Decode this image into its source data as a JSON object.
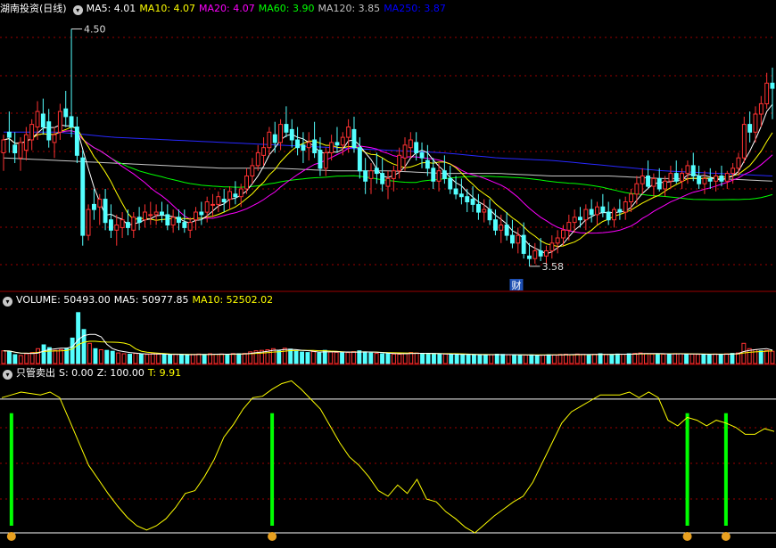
{
  "price_panel": {
    "title": "湖南投资(日线)",
    "ma": [
      {
        "label": "MA5: 4.01",
        "color": "#ffffff"
      },
      {
        "label": "MA10: 4.07",
        "color": "#ffff00"
      },
      {
        "label": "MA20: 4.07",
        "color": "#ff00ff"
      },
      {
        "label": "MA60: 3.90",
        "color": "#00ff00"
      },
      {
        "label": "MA120: 3.85",
        "color": "#c0c0c0"
      },
      {
        "label": "MA250: 3.87",
        "color": "#0000ff"
      }
    ],
    "high_label": "4.50",
    "low_label": "3.58",
    "event_badge": "财"
  },
  "volume_panel": {
    "label": "VOLUME: 50493.00",
    "ma": [
      {
        "label": "MA5: 50977.85",
        "color": "#ffffff"
      },
      {
        "label": "MA10: 52502.02",
        "color": "#ffff00"
      }
    ]
  },
  "indicator_panel": {
    "title": "只管卖出",
    "values": [
      {
        "label": "S: 0.00",
        "color": "#ffffff"
      },
      {
        "label": "Z: 100.00",
        "color": "#ffffff"
      },
      {
        "label": "T: 9.91",
        "color": "#ffff00"
      }
    ]
  },
  "colors": {
    "up": "#ff3232",
    "down": "#54ffff",
    "grid": "#9b0000",
    "signal": "#00ff00",
    "t_line": "#ffff00"
  },
  "chart_data": [
    {
      "type": "candlestick",
      "title": "湖南投资(日线)",
      "ylim": [
        3.5,
        4.55
      ],
      "series_note": "daily OHLC, estimated from the figure",
      "ohlc": [
        [
          4.02,
          4.09,
          3.95,
          4.07
        ],
        [
          4.1,
          4.18,
          4.02,
          4.08
        ],
        [
          4.05,
          4.1,
          3.98,
          4.02
        ],
        [
          4.0,
          4.08,
          3.95,
          4.06
        ],
        [
          4.03,
          4.12,
          3.99,
          4.09
        ],
        [
          4.07,
          4.15,
          4.03,
          4.13
        ],
        [
          4.12,
          4.22,
          4.07,
          4.18
        ],
        [
          4.17,
          4.23,
          4.09,
          4.12
        ],
        [
          4.14,
          4.19,
          4.04,
          4.07
        ],
        [
          4.06,
          4.12,
          4.0,
          4.09
        ],
        [
          4.1,
          4.21,
          4.07,
          4.18
        ],
        [
          4.19,
          4.26,
          4.12,
          4.16
        ],
        [
          4.16,
          4.5,
          4.08,
          4.12
        ],
        [
          4.12,
          4.16,
          3.98,
          4.01
        ],
        [
          4.0,
          4.03,
          3.66,
          3.7
        ],
        [
          3.7,
          3.82,
          3.68,
          3.8
        ],
        [
          3.82,
          3.88,
          3.76,
          3.8
        ],
        [
          3.81,
          3.86,
          3.74,
          3.84
        ],
        [
          3.84,
          3.88,
          3.72,
          3.75
        ],
        [
          3.76,
          3.82,
          3.69,
          3.72
        ],
        [
          3.72,
          3.78,
          3.66,
          3.74
        ],
        [
          3.73,
          3.79,
          3.69,
          3.76
        ],
        [
          3.75,
          3.8,
          3.7,
          3.73
        ],
        [
          3.72,
          3.79,
          3.69,
          3.77
        ],
        [
          3.77,
          3.81,
          3.72,
          3.75
        ],
        [
          3.76,
          3.82,
          3.73,
          3.79
        ],
        [
          3.78,
          3.83,
          3.74,
          3.78
        ],
        [
          3.78,
          3.82,
          3.74,
          3.79
        ],
        [
          3.79,
          3.83,
          3.75,
          3.78
        ],
        [
          3.78,
          3.82,
          3.72,
          3.74
        ],
        [
          3.74,
          3.8,
          3.71,
          3.77
        ],
        [
          3.77,
          3.8,
          3.72,
          3.75
        ],
        [
          3.75,
          3.8,
          3.71,
          3.73
        ],
        [
          3.72,
          3.77,
          3.69,
          3.75
        ],
        [
          3.76,
          3.81,
          3.72,
          3.79
        ],
        [
          3.79,
          3.83,
          3.74,
          3.78
        ],
        [
          3.79,
          3.85,
          3.75,
          3.83
        ],
        [
          3.82,
          3.86,
          3.77,
          3.82
        ],
        [
          3.82,
          3.87,
          3.79,
          3.85
        ],
        [
          3.84,
          3.88,
          3.79,
          3.83
        ],
        [
          3.84,
          3.89,
          3.8,
          3.87
        ],
        [
          3.86,
          3.91,
          3.82,
          3.85
        ],
        [
          3.85,
          3.9,
          3.81,
          3.88
        ],
        [
          3.88,
          3.96,
          3.86,
          3.93
        ],
        [
          3.93,
          4.0,
          3.9,
          3.97
        ],
        [
          3.97,
          4.05,
          3.95,
          4.02
        ],
        [
          4.01,
          4.08,
          3.97,
          4.04
        ],
        [
          4.04,
          4.12,
          4.01,
          4.1
        ],
        [
          4.09,
          4.14,
          4.02,
          4.06
        ],
        [
          4.06,
          4.15,
          4.03,
          4.13
        ],
        [
          4.13,
          4.2,
          4.08,
          4.1
        ],
        [
          4.11,
          4.15,
          4.04,
          4.07
        ],
        [
          4.07,
          4.12,
          4.01,
          4.04
        ],
        [
          4.05,
          4.1,
          3.98,
          4.03
        ],
        [
          4.04,
          4.1,
          3.99,
          4.06
        ],
        [
          4.07,
          4.14,
          4.0,
          4.02
        ],
        [
          4.03,
          4.08,
          3.93,
          3.96
        ],
        [
          3.96,
          4.04,
          3.93,
          4.02
        ],
        [
          4.02,
          4.09,
          3.99,
          4.06
        ],
        [
          4.06,
          4.12,
          4.02,
          4.05
        ],
        [
          4.05,
          4.1,
          4.01,
          4.08
        ],
        [
          4.08,
          4.15,
          4.02,
          4.12
        ],
        [
          4.11,
          4.16,
          4.02,
          4.04
        ],
        [
          4.04,
          4.08,
          3.92,
          3.95
        ],
        [
          3.95,
          4.0,
          3.86,
          3.91
        ],
        [
          3.92,
          3.98,
          3.86,
          3.95
        ],
        [
          3.96,
          4.02,
          3.9,
          3.94
        ],
        [
          3.94,
          4.0,
          3.87,
          3.9
        ],
        [
          3.89,
          3.95,
          3.84,
          3.92
        ],
        [
          3.92,
          3.97,
          3.87,
          3.95
        ],
        [
          3.95,
          4.04,
          3.92,
          4.01
        ],
        [
          4.0,
          4.08,
          3.95,
          4.05
        ],
        [
          4.04,
          4.1,
          4.0,
          4.07
        ],
        [
          4.06,
          4.1,
          3.99,
          4.02
        ],
        [
          4.02,
          4.06,
          3.96,
          4.0
        ],
        [
          3.99,
          4.05,
          3.93,
          3.96
        ],
        [
          3.96,
          4.0,
          3.88,
          3.91
        ],
        [
          3.91,
          3.98,
          3.87,
          3.95
        ],
        [
          3.95,
          4.01,
          3.9,
          3.92
        ],
        [
          3.92,
          3.97,
          3.86,
          3.88
        ],
        [
          3.88,
          3.93,
          3.84,
          3.86
        ],
        [
          3.86,
          3.92,
          3.82,
          3.85
        ],
        [
          3.85,
          3.88,
          3.79,
          3.83
        ],
        [
          3.84,
          3.89,
          3.79,
          3.82
        ],
        [
          3.82,
          3.86,
          3.76,
          3.79
        ],
        [
          3.79,
          3.84,
          3.75,
          3.8
        ],
        [
          3.8,
          3.84,
          3.74,
          3.76
        ],
        [
          3.76,
          3.8,
          3.7,
          3.72
        ],
        [
          3.72,
          3.78,
          3.67,
          3.74
        ],
        [
          3.74,
          3.79,
          3.68,
          3.7
        ],
        [
          3.7,
          3.76,
          3.65,
          3.67
        ],
        [
          3.67,
          3.73,
          3.63,
          3.7
        ],
        [
          3.7,
          3.75,
          3.61,
          3.63
        ],
        [
          3.62,
          3.67,
          3.58,
          3.61
        ],
        [
          3.61,
          3.67,
          3.59,
          3.64
        ],
        [
          3.64,
          3.69,
          3.6,
          3.62
        ],
        [
          3.62,
          3.66,
          3.59,
          3.64
        ],
        [
          3.64,
          3.7,
          3.61,
          3.67
        ],
        [
          3.67,
          3.72,
          3.63,
          3.69
        ],
        [
          3.69,
          3.74,
          3.66,
          3.72
        ],
        [
          3.72,
          3.78,
          3.68,
          3.75
        ],
        [
          3.75,
          3.8,
          3.71,
          3.77
        ],
        [
          3.77,
          3.81,
          3.73,
          3.76
        ],
        [
          3.76,
          3.82,
          3.72,
          3.8
        ],
        [
          3.8,
          3.84,
          3.75,
          3.78
        ],
        [
          3.78,
          3.83,
          3.74,
          3.81
        ],
        [
          3.81,
          3.86,
          3.77,
          3.79
        ],
        [
          3.79,
          3.83,
          3.74,
          3.76
        ],
        [
          3.76,
          3.81,
          3.73,
          3.8
        ],
        [
          3.8,
          3.84,
          3.76,
          3.79
        ],
        [
          3.79,
          3.85,
          3.76,
          3.83
        ],
        [
          3.83,
          3.88,
          3.79,
          3.86
        ],
        [
          3.86,
          3.93,
          3.82,
          3.9
        ],
        [
          3.9,
          3.96,
          3.86,
          3.93
        ],
        [
          3.93,
          3.99,
          3.88,
          3.89
        ],
        [
          3.89,
          3.94,
          3.85,
          3.92
        ],
        [
          3.92,
          3.96,
          3.87,
          3.88
        ],
        [
          3.88,
          3.93,
          3.85,
          3.91
        ],
        [
          3.91,
          3.97,
          3.88,
          3.94
        ],
        [
          3.94,
          3.99,
          3.9,
          3.91
        ],
        [
          3.91,
          3.96,
          3.88,
          3.94
        ],
        [
          3.94,
          3.99,
          3.9,
          3.97
        ],
        [
          3.97,
          4.02,
          3.91,
          3.93
        ],
        [
          3.93,
          3.97,
          3.88,
          3.9
        ],
        [
          3.9,
          3.95,
          3.86,
          3.92
        ],
        [
          3.92,
          3.96,
          3.88,
          3.91
        ],
        [
          3.91,
          3.95,
          3.87,
          3.93
        ],
        [
          3.93,
          3.97,
          3.89,
          3.91
        ],
        [
          3.91,
          3.95,
          3.88,
          3.94
        ],
        [
          3.94,
          3.98,
          3.9,
          3.96
        ],
        [
          3.96,
          4.02,
          3.93,
          4.0
        ],
        [
          4.0,
          4.16,
          3.98,
          4.13
        ],
        [
          4.13,
          4.18,
          4.06,
          4.1
        ],
        [
          4.1,
          4.2,
          4.06,
          4.17
        ],
        [
          4.17,
          4.24,
          4.12,
          4.21
        ],
        [
          4.21,
          4.33,
          4.19,
          4.29
        ],
        [
          4.29,
          4.35,
          4.15,
          4.27
        ]
      ],
      "ma_series": [
        {
          "name": "MA5",
          "color": "#ffffff",
          "window": 5
        },
        {
          "name": "MA10",
          "color": "#ffff00",
          "window": 10
        },
        {
          "name": "MA20",
          "color": "#ff00ff",
          "window": 20
        },
        {
          "name": "MA60",
          "color": "#00ff00",
          "window": 60
        }
      ],
      "ma120_values": [
        4.0,
        3.99,
        3.98,
        3.97,
        3.96,
        3.96,
        3.95,
        3.95,
        3.94,
        3.94,
        3.93,
        3.93,
        3.92,
        3.92,
        3.91
      ],
      "ma250_values": [
        4.1,
        4.1,
        4.08,
        4.07,
        4.06,
        4.05,
        4.04,
        4.03,
        4.02,
        4.0,
        3.99,
        3.97,
        3.95,
        3.94,
        3.93
      ]
    },
    {
      "type": "bar",
      "title": "VOLUME",
      "ylim": [
        0,
        260000
      ],
      "values": [
        60000,
        58000,
        42000,
        38000,
        46000,
        52000,
        70000,
        88000,
        75000,
        62000,
        66000,
        72000,
        120000,
        240000,
        160000,
        95000,
        70000,
        65000,
        62000,
        58000,
        50000,
        46000,
        44000,
        48000,
        45000,
        43000,
        47000,
        45000,
        42000,
        40000,
        44000,
        42000,
        41000,
        43000,
        45000,
        42000,
        46000,
        44000,
        45000,
        43000,
        47000,
        46000,
        48000,
        55000,
        60000,
        62000,
        65000,
        70000,
        60000,
        72000,
        68000,
        58000,
        54000,
        52000,
        56000,
        50000,
        62000,
        55000,
        53000,
        50000,
        52000,
        56000,
        60000,
        55000,
        50000,
        48000,
        46000,
        47000,
        45000,
        44000,
        48000,
        52000,
        50000,
        47000,
        45000,
        44000,
        46000,
        45000,
        43000,
        42000,
        41000,
        43000,
        42000,
        41000,
        40000,
        42000,
        44000,
        43000,
        41000,
        40000,
        39000,
        40000,
        41000,
        38000,
        40000,
        42000,
        41000,
        43000,
        44000,
        42000,
        45000,
        43000,
        41000,
        44000,
        46000,
        43000,
        42000,
        45000,
        44000,
        46000,
        48000,
        50000,
        47000,
        45000,
        46000,
        44000,
        45000,
        47000,
        46000,
        45000,
        44000,
        43000,
        42000,
        44000,
        45000,
        44000,
        46000,
        48000,
        50000,
        95000,
        70000,
        65000,
        60000,
        62000,
        58000
      ],
      "ma_series": [
        {
          "name": "MA5",
          "color": "#ffffff"
        },
        {
          "name": "MA10",
          "color": "#ffff00"
        }
      ]
    },
    {
      "type": "line",
      "title": "只管卖出",
      "ylim": [
        0,
        100
      ],
      "series": [
        {
          "name": "T",
          "color": "#ffff00",
          "values": [
            96,
            98,
            100,
            99,
            98,
            100,
            96,
            80,
            64,
            48,
            38,
            28,
            19,
            11,
            5,
            2,
            5,
            10,
            18,
            28,
            30,
            40,
            52,
            68,
            77,
            88,
            96,
            97,
            102,
            106,
            108,
            102,
            95,
            88,
            76,
            64,
            54,
            48,
            40,
            30,
            26,
            34,
            28,
            38,
            24,
            22,
            15,
            10,
            4,
            0,
            6,
            12,
            17,
            22,
            26,
            36,
            50,
            64,
            78,
            86,
            90,
            94,
            98,
            98,
            98,
            100,
            96,
            100,
            96,
            80,
            76,
            82,
            80,
            76,
            80,
            78,
            75,
            70,
            70,
            74,
            72
          ]
        }
      ],
      "signals_at_index": [
        1,
        28,
        71,
        75
      ]
    }
  ]
}
